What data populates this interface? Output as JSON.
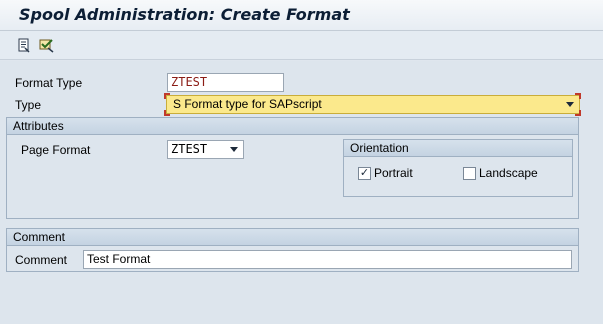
{
  "window": {
    "title": "Spool Administration: Create Format"
  },
  "toolbar": {
    "buttons": [
      {
        "icon": "other-object-icon"
      },
      {
        "icon": "check-icon"
      }
    ]
  },
  "header_fields": {
    "format_type_label": "Format Type",
    "format_type_value": "ZTEST",
    "type_label": "Type",
    "type_value": "S Format type for SAPscript"
  },
  "attributes": {
    "title": "Attributes",
    "page_format_label": "Page Format",
    "page_format_value": "ZTEST",
    "orientation": {
      "title": "Orientation",
      "portrait_label": "Portrait",
      "portrait_checked": true,
      "landscape_label": "Landscape",
      "landscape_checked": false
    }
  },
  "comment": {
    "title": "Comment",
    "label": "Comment",
    "value": "Test Format"
  },
  "colors": {
    "focus_field": "#fbe98c",
    "title_text": "#0c1e35",
    "value_red": "#8b1b14"
  }
}
